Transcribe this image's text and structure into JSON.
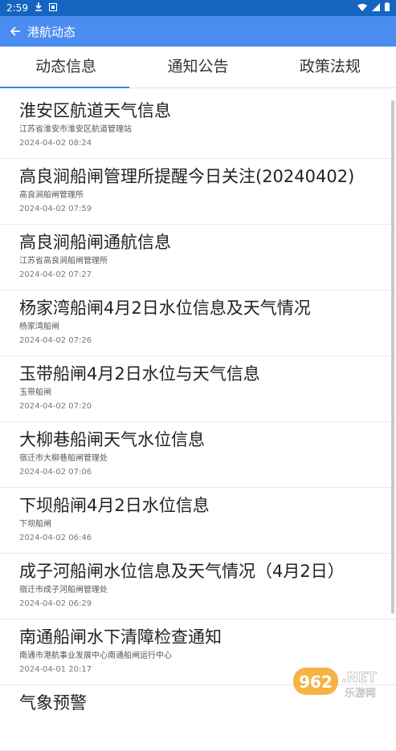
{
  "status_bar": {
    "time": "2:59"
  },
  "header": {
    "title": "港航动态"
  },
  "tabs": [
    {
      "label": "动态信息",
      "active": true
    },
    {
      "label": "通知公告",
      "active": false
    },
    {
      "label": "政策法规",
      "active": false
    }
  ],
  "items": [
    {
      "title": "淮安区航道天气信息",
      "source": "江苏省淮安市淮安区航道管理站",
      "time": "2024-04-02 08:24"
    },
    {
      "title": "高良涧船闸管理所提醒今日关注(20240402)",
      "source": "高良涧船闸管理所",
      "time": "2024-04-02 07:59"
    },
    {
      "title": "高良涧船闸通航信息",
      "source": "江苏省高良涧船闸管理所",
      "time": "2024-04-02 07:27"
    },
    {
      "title": "杨家湾船闸4月2日水位信息及天气情况",
      "source": "杨家湾船闸",
      "time": "2024-04-02 07:26"
    },
    {
      "title": "玉带船闸4月2日水位与天气信息",
      "source": "玉带船闸",
      "time": "2024-04-02 07:20"
    },
    {
      "title": "大柳巷船闸天气水位信息",
      "source": "宿迁市大柳巷船闸管理处",
      "time": "2024-04-02 07:06"
    },
    {
      "title": "下坝船闸4月2日水位信息",
      "source": "下坝船闸",
      "time": "2024-04-02 06:46"
    },
    {
      "title": "成子河船闸水位信息及天气情况（4月2日）",
      "source": "宿迁市成子河船闸管理处",
      "time": "2024-04-02 06:29"
    },
    {
      "title": "南通船闸水下清障检查通知",
      "source": "南通市港航事业发展中心南通船闸运行中心",
      "time": "2024-04-01 20:17"
    },
    {
      "title": "气象预警",
      "source": "",
      "time": ""
    }
  ],
  "watermark": {
    "brand": "962",
    "suffix": ".NET",
    "subtitle": "乐游网"
  },
  "colors": {
    "status_bar": "#1565c0",
    "app_bar": "#4a8cf0",
    "tab_indicator": "#3d7fe6"
  }
}
